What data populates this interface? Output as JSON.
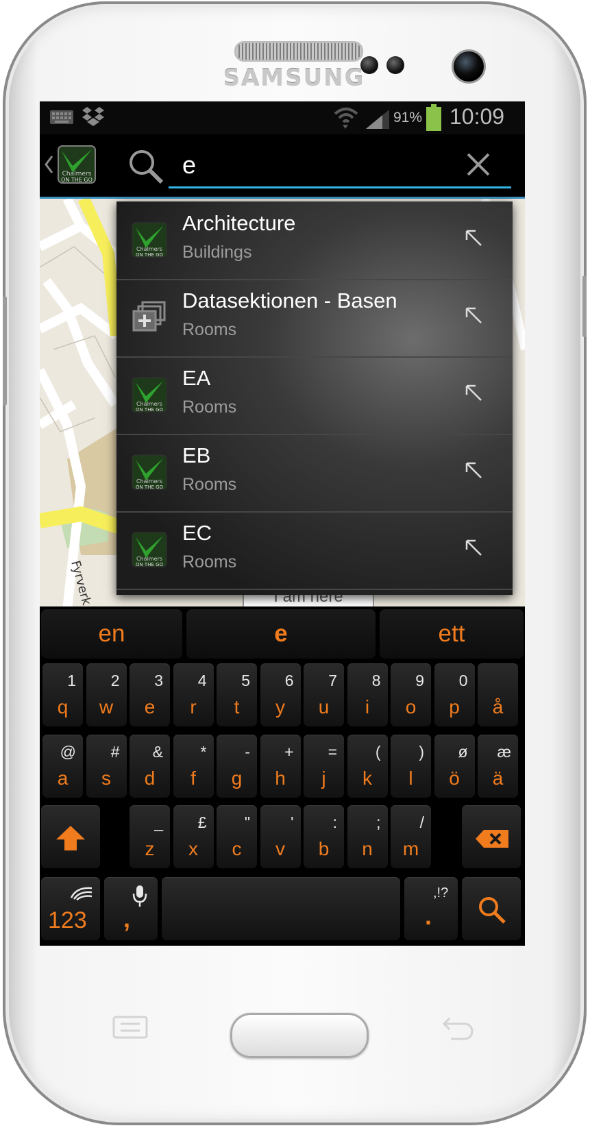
{
  "device": {
    "brand": "SAMSUNG"
  },
  "status_bar": {
    "battery": "91%",
    "time": "10:09"
  },
  "action_bar": {
    "app_icon_alt": "Chalmers On the Go",
    "search_query": "e"
  },
  "suggestions": [
    {
      "title": "Architecture",
      "subtitle": "Buildings",
      "icon": "chalmers-logo-icon"
    },
    {
      "title": "Datasektionen - Basen",
      "subtitle": "Rooms",
      "icon": "stacked-plus-icon"
    },
    {
      "title": "EA",
      "subtitle": "Rooms",
      "icon": "chalmers-logo-icon"
    },
    {
      "title": "EB",
      "subtitle": "Rooms",
      "icon": "chalmers-logo-icon"
    },
    {
      "title": "EC",
      "subtitle": "Rooms",
      "icon": "chalmers-logo-icon"
    }
  ],
  "map": {
    "label_i_am_here": "I am here",
    "street_label": "Fyrverk"
  },
  "keyboard": {
    "predictions": [
      "en",
      "e",
      "ett"
    ],
    "row1": [
      {
        "sec": "1",
        "main": "q"
      },
      {
        "sec": "2",
        "main": "w"
      },
      {
        "sec": "3",
        "main": "e"
      },
      {
        "sec": "4",
        "main": "r"
      },
      {
        "sec": "5",
        "main": "t"
      },
      {
        "sec": "6",
        "main": "y"
      },
      {
        "sec": "7",
        "main": "u"
      },
      {
        "sec": "8",
        "main": "i"
      },
      {
        "sec": "9",
        "main": "o"
      },
      {
        "sec": "0",
        "main": "p"
      },
      {
        "sec": "",
        "main": "å"
      }
    ],
    "row2": [
      {
        "sec": "@",
        "main": "a"
      },
      {
        "sec": "#",
        "main": "s"
      },
      {
        "sec": "&",
        "main": "d"
      },
      {
        "sec": "*",
        "main": "f"
      },
      {
        "sec": "-",
        "main": "g"
      },
      {
        "sec": "+",
        "main": "h"
      },
      {
        "sec": "=",
        "main": "j"
      },
      {
        "sec": "(",
        "main": "k"
      },
      {
        "sec": ")",
        "main": "l"
      },
      {
        "sec": "ø",
        "main": "ö"
      },
      {
        "sec": "æ",
        "main": "ä"
      }
    ],
    "row3": [
      {
        "sec": "_",
        "main": "z"
      },
      {
        "sec": "£",
        "main": "x"
      },
      {
        "sec": "\"",
        "main": "c"
      },
      {
        "sec": "'",
        "main": "v"
      },
      {
        "sec": ":",
        "main": "b"
      },
      {
        "sec": ";",
        "main": "n"
      },
      {
        "sec": "/",
        "main": "m"
      }
    ],
    "numbers_label": "123",
    "comma_label": ",",
    "punct_sec": ",!?",
    "punct_main": "."
  },
  "colors": {
    "accent_orange": "#f07c1e",
    "search_underline": "#33b5e5",
    "battery_green": "#8bc34a"
  }
}
